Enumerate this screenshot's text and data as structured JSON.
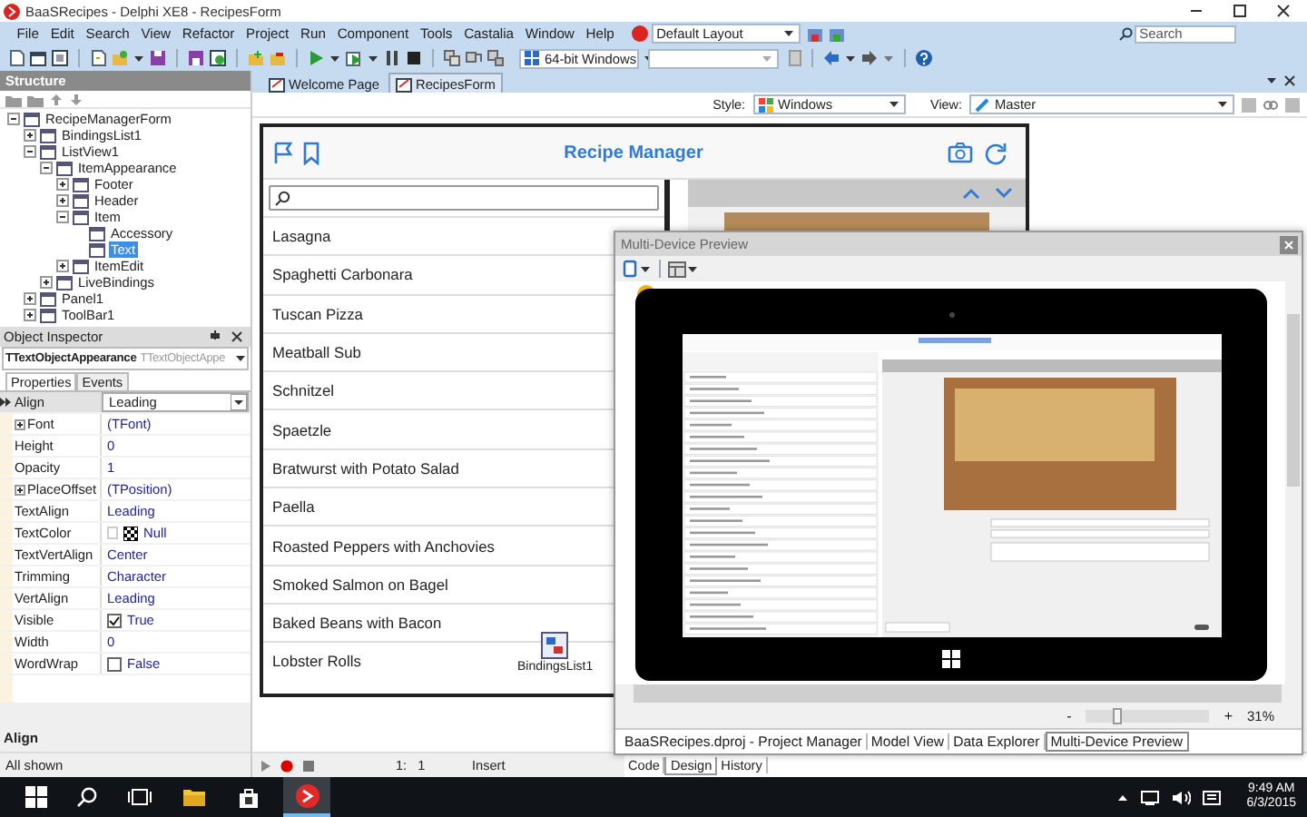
{
  "window": {
    "title": "BaaSRecipes - Delphi XE8 - RecipesForm"
  },
  "menu": [
    "File",
    "Edit",
    "Search",
    "View",
    "Refactor",
    "Project",
    "Run",
    "Component",
    "Tools",
    "Castalia",
    "Window",
    "Help"
  ],
  "layout_combo": {
    "value": "Default Layout"
  },
  "search": {
    "placeholder": "Search"
  },
  "platform_combo": {
    "value": "64-bit Windows"
  },
  "structure": {
    "title": "Structure",
    "tree": [
      {
        "label": "RecipeManagerForm",
        "expanded": true,
        "selected": false,
        "children": [
          {
            "label": "BindingsList1",
            "expanded": false,
            "selected": false
          },
          {
            "label": "ListView1",
            "expanded": true,
            "selected": false,
            "children": [
              {
                "label": "ItemAppearance",
                "expanded": true,
                "selected": false,
                "children": [
                  {
                    "label": "Footer",
                    "expanded": false,
                    "selected": false
                  },
                  {
                    "label": "Header",
                    "expanded": false,
                    "selected": false
                  },
                  {
                    "label": "Item",
                    "expanded": true,
                    "selected": false,
                    "children": [
                      {
                        "label": "Accessory",
                        "selected": false
                      },
                      {
                        "label": "Text",
                        "selected": true
                      }
                    ]
                  },
                  {
                    "label": "ItemEdit",
                    "expanded": false,
                    "selected": false
                  }
                ]
              },
              {
                "label": "LiveBindings",
                "expanded": false,
                "selected": false
              }
            ]
          },
          {
            "label": "Panel1",
            "expanded": false,
            "selected": false
          },
          {
            "label": "ToolBar1",
            "expanded": false,
            "selected": false
          }
        ]
      }
    ]
  },
  "editor_tabs": [
    {
      "label": "Welcome Page",
      "selected": false
    },
    {
      "label": "RecipesForm",
      "selected": true
    }
  ],
  "object_inspector": {
    "title": "Object Inspector",
    "component": "TTextObjectAppearance",
    "component_type": "TTextObjectAppe",
    "tabs": [
      {
        "label": "Properties",
        "selected": true
      },
      {
        "label": "Events",
        "selected": false
      }
    ],
    "properties": [
      {
        "name": "Align",
        "value": "Leading",
        "kind": "combo",
        "selected": true
      },
      {
        "name": "Font",
        "value": "(TFont)",
        "kind": "expandable",
        "selected": false
      },
      {
        "name": "Height",
        "value": "0",
        "kind": "text",
        "selected": false
      },
      {
        "name": "Opacity",
        "value": "1",
        "kind": "text",
        "selected": false
      },
      {
        "name": "PlaceOffset",
        "value": "(TPosition)",
        "kind": "expandable",
        "selected": false
      },
      {
        "name": "TextAlign",
        "value": "Leading",
        "kind": "text",
        "selected": false
      },
      {
        "name": "TextColor",
        "value": "Null",
        "kind": "color",
        "selected": false
      },
      {
        "name": "TextVertAlign",
        "value": "Center",
        "kind": "text",
        "selected": false
      },
      {
        "name": "Trimming",
        "value": "Character",
        "kind": "text",
        "selected": false
      },
      {
        "name": "VertAlign",
        "value": "Leading",
        "kind": "text",
        "selected": false
      },
      {
        "name": "Visible",
        "value": "True",
        "kind": "check",
        "checked": true,
        "selected": false
      },
      {
        "name": "Width",
        "value": "0",
        "kind": "text",
        "selected": false
      },
      {
        "name": "WordWrap",
        "value": "False",
        "kind": "check",
        "checked": false,
        "selected": false
      }
    ],
    "description": "Align",
    "status": "All shown"
  },
  "designer": {
    "style_label": "Style:",
    "style": "Windows",
    "view_label": "View:",
    "view": "Master",
    "form": {
      "title": "Recipe Manager",
      "recipes": [
        "Lasagna",
        "Spaghetti Carbonara",
        "Tuscan Pizza",
        "Meatball Sub",
        "Schnitzel",
        "Spaetzle",
        "Bratwurst with Potato Salad",
        "Paella",
        "Roasted Peppers with Anchovies",
        "Smoked Salmon on Bagel",
        "Baked Beans with Bacon",
        "Lobster Rolls"
      ]
    },
    "component_label": "BindingsList1"
  },
  "preview": {
    "title": "Multi-Device Preview",
    "zoom_minus": "-",
    "zoom_plus": "+",
    "zoom": "31%",
    "zoom_slider": {
      "level": 0.24
    },
    "tabs": [
      {
        "label": "BaaSRecipes.dproj - Project Manager",
        "selected": false
      },
      {
        "label": "Model View",
        "selected": false
      },
      {
        "label": "Data Explorer",
        "selected": false
      },
      {
        "label": "Multi-Device Preview",
        "selected": true
      }
    ]
  },
  "editor_status": {
    "position": "1:   1",
    "mode": "Insert"
  },
  "view_tabs": [
    {
      "label": "Code",
      "selected": false
    },
    {
      "label": "Design",
      "selected": true
    },
    {
      "label": "History",
      "selected": false
    }
  ],
  "taskbar": {
    "time": "9:49 AM",
    "date": "6/3/2015"
  }
}
